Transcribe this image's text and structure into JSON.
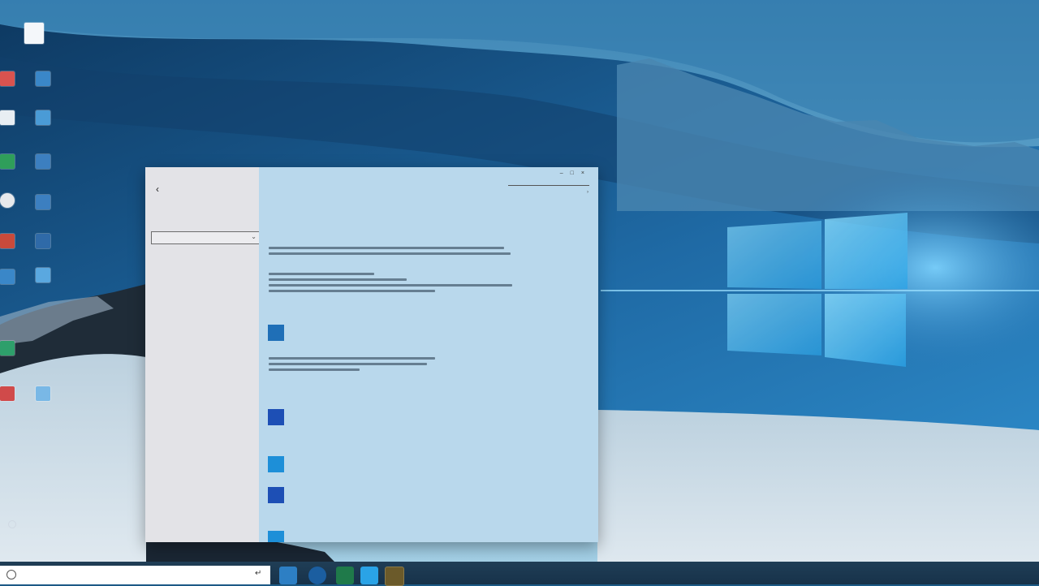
{
  "settings": {
    "nav": {
      "items": []
    },
    "content": {
      "page_title": "",
      "section_title": ""
    },
    "search_placeholder": ""
  },
  "taskbar": {
    "search_placeholder": ""
  },
  "colors": {
    "nav_bg": "#e3e3e7",
    "content_bg": "#b9d8ec",
    "accent": "#1f6fb7",
    "taskbar_bg": "#17324a"
  }
}
